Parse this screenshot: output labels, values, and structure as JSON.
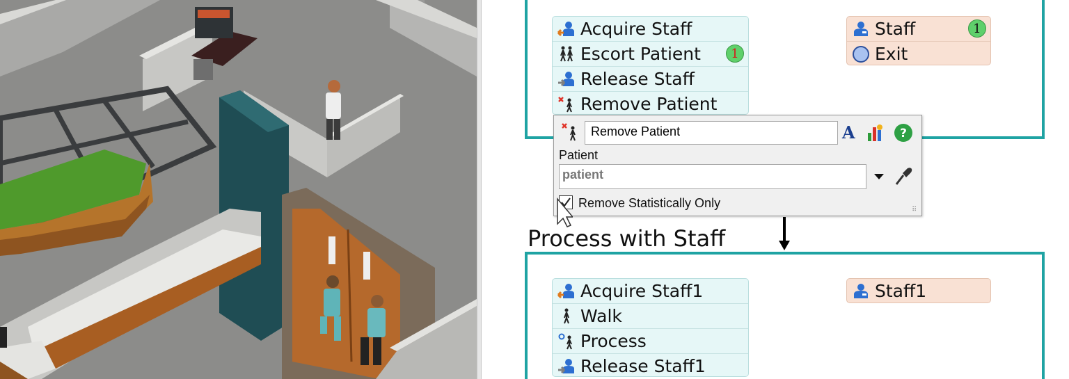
{
  "flow": {
    "top_container": {
      "activities": [
        {
          "label": "Acquire Staff",
          "icon": "acquire-staff-icon"
        },
        {
          "label": "Escort Patient",
          "icon": "escort-patient-icon",
          "badge": "1"
        },
        {
          "label": "Release Staff",
          "icon": "release-staff-icon"
        },
        {
          "label": "Remove Patient",
          "icon": "remove-patient-icon"
        }
      ],
      "resources": [
        {
          "label": "Staff",
          "icon": "staff-icon",
          "badge": "1"
        },
        {
          "label": "Exit",
          "icon": "exit-circle-icon"
        }
      ]
    },
    "process_group": {
      "title": "Process with Staff",
      "activities": [
        {
          "label": "Acquire Staff1",
          "icon": "acquire-staff-icon"
        },
        {
          "label": "Walk",
          "icon": "walk-icon"
        },
        {
          "label": "Process",
          "icon": "process-icon"
        },
        {
          "label": "Release Staff1",
          "icon": "release-staff-icon"
        }
      ],
      "resources": [
        {
          "label": "Staff1",
          "icon": "staff-icon"
        }
      ]
    }
  },
  "popup": {
    "name_value": "Remove Patient",
    "patient_label": "Patient",
    "patient_value": "patient",
    "checkbox_label": "Remove Statistically Only",
    "checkbox_checked": true
  },
  "colors": {
    "container_border": "#1fa3a3",
    "activity_fill": "#e6f7f7",
    "resource_fill": "#f9e1d4",
    "badge_green": "#5fd06b"
  }
}
